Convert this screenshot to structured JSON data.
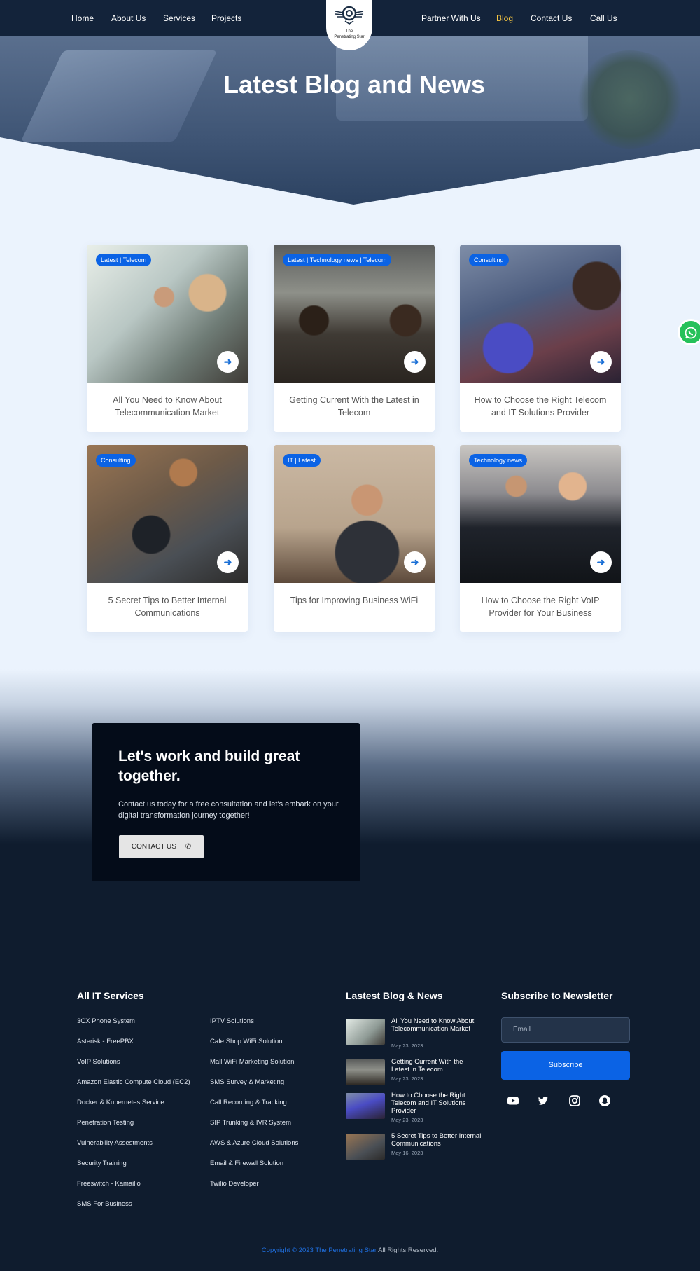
{
  "nav": {
    "left": [
      "Home",
      "About Us",
      "Services",
      "Projects"
    ],
    "right": [
      "Partner With Us",
      "Blog",
      "Contact Us",
      "Call Us"
    ],
    "active": "Blog",
    "logo_text_1": "The",
    "logo_text_2": "Penetrating Star"
  },
  "hero": {
    "title": "Latest Blog and News"
  },
  "posts": [
    {
      "tag": "Latest | Telecom",
      "title": "All You Need to Know About Telecommunication Market"
    },
    {
      "tag": "Latest | Technology news | Telecom",
      "title": "Getting Current With the Latest in Telecom"
    },
    {
      "tag": "Consulting",
      "title": "How to Choose the Right Telecom and IT Solutions Provider"
    },
    {
      "tag": "Consulting",
      "title": "5 Secret Tips to Better Internal Communications"
    },
    {
      "tag": "IT | Latest",
      "title": "Tips for Improving Business WiFi"
    },
    {
      "tag": "Technology news",
      "title": "How to Choose the Right VoIP Provider for Your Business"
    }
  ],
  "cta": {
    "title": "Let's work and build great together.",
    "text": "Contact us today for a free consultation and let's embark on your digital transformation journey together!",
    "button": "CONTACT US"
  },
  "footer": {
    "services_heading": "All IT Services",
    "services_col1": [
      "3CX Phone System",
      "Asterisk - FreePBX",
      "VoIP Solutions",
      "Amazon Elastic Compute Cloud (EC2)",
      "Docker & Kubernetes Service",
      "Penetration Testing",
      "Vulnerability Assestments",
      "Security Training",
      "Freeswitch - Kamailio",
      "SMS For Business"
    ],
    "services_col2": [
      "IPTV Solutions",
      "Cafe Shop WiFi Solution",
      "Mall WiFi Marketing Solution",
      "SMS Survey & Marketing",
      "Call Recording & Tracking",
      "SIP Trunking & IVR System",
      "AWS & Azure Cloud Solutions",
      "Email & Firewall Solution",
      "Twilio Developer"
    ],
    "blog_heading": "Lastest Blog & News",
    "blog_posts": [
      {
        "title": "All You Need to Know About Telecommunication Market",
        "date": "May 23, 2023"
      },
      {
        "title": "Getting Current With the Latest in Telecom",
        "date": "May 23, 2023"
      },
      {
        "title": "How to Choose the Right Telecom and IT Solutions Provider",
        "date": "May 23, 2023"
      },
      {
        "title": "5 Secret Tips to Better Internal Communications",
        "date": "May 16, 2023"
      }
    ],
    "newsletter_heading": "Subscribe to Newsletter",
    "email_placeholder": "Email",
    "subscribe_button": "Subscribe",
    "social_icons": [
      "youtube-icon",
      "twitter-icon",
      "instagram-icon",
      "snapchat-icon"
    ],
    "copyright_brand": "Copyright © 2023 The Penetrating Star",
    "copyright_rest": "All Rights Reserved."
  },
  "colors": {
    "nav_bg": "#13233a",
    "accent": "#0b63e5",
    "active_nav": "#f5c542",
    "footer_bg": "#0f1c2e",
    "light_bg": "#ebf3fd"
  }
}
